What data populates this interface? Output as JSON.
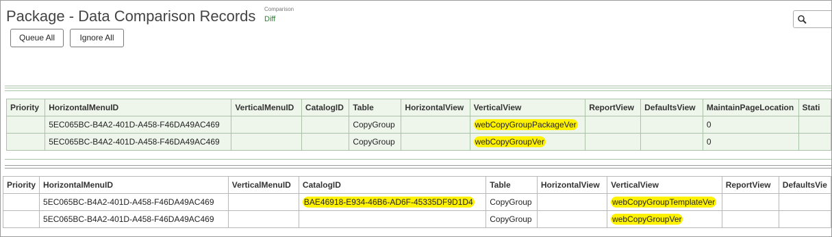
{
  "header": {
    "title": "Package - Data Comparison Records",
    "comparison_label": "Comparison",
    "comparison_value": "Diff",
    "queue_all_label": "Queue All",
    "ignore_all_label": "Ignore All"
  },
  "table1": {
    "columns": [
      "Priority",
      "HorizontalMenuID",
      "VerticalMenuID",
      "CatalogID",
      "Table",
      "HorizontalView",
      "VerticalView",
      "ReportView",
      "DefaultsView",
      "MaintainPageLocation",
      "Stati"
    ],
    "rows": [
      [
        "",
        "5EC065BC-B4A2-401D-A458-F46DA49AC469",
        "",
        "",
        "CopyGroup",
        "",
        "webCopyGroupPackageVer",
        "",
        "",
        "0",
        ""
      ],
      [
        "",
        "5EC065BC-B4A2-401D-A458-F46DA49AC469",
        "",
        "",
        "CopyGroup",
        "",
        "webCopyGroupVer",
        "",
        "",
        "0",
        ""
      ]
    ]
  },
  "table2": {
    "columns": [
      "Priority",
      "HorizontalMenuID",
      "VerticalMenuID",
      "CatalogID",
      "Table",
      "HorizontalView",
      "VerticalView",
      "ReportView",
      "DefaultsVie"
    ],
    "rows": [
      [
        "",
        "5EC065BC-B4A2-401D-A458-F46DA49AC469",
        "",
        "BAE46918-E934-46B6-AD6F-45335DF9D1D4",
        "CopyGroup",
        "",
        "webCopyGroupTemplateVer",
        "",
        ""
      ],
      [
        "",
        "5EC065BC-B4A2-401D-A458-F46DA49AC469",
        "",
        "",
        "CopyGroup",
        "",
        "webCopyGroupVer",
        "",
        ""
      ]
    ]
  },
  "colors": {
    "highlight": "#fff200",
    "grid_green_bg": "#eef6ec",
    "diff_text": "#2e7d32"
  },
  "icons": {
    "search": "magnifier-icon"
  }
}
